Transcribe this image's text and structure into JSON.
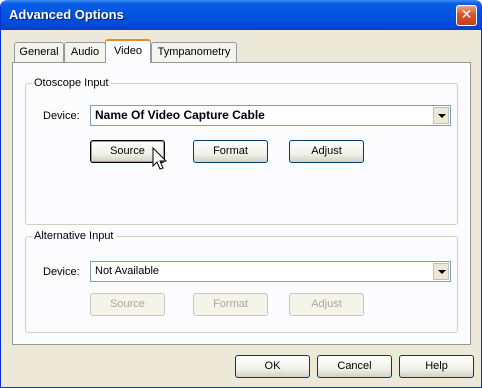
{
  "window": {
    "title": "Advanced Options",
    "close_icon": "close-icon"
  },
  "tabs": [
    {
      "label": "General",
      "active": false
    },
    {
      "label": "Audio",
      "active": false
    },
    {
      "label": "Video",
      "active": true
    },
    {
      "label": "Tympanometry",
      "active": false
    }
  ],
  "otoscope": {
    "legend": "Otoscope Input",
    "device_label": "Device:",
    "device_value": "Name Of Video Capture Cable",
    "buttons": {
      "source": "Source",
      "format": "Format",
      "adjust": "Adjust"
    }
  },
  "alternative": {
    "legend": "Alternative Input",
    "device_label": "Device:",
    "device_value": "Not Available",
    "buttons": {
      "source": "Source",
      "format": "Format",
      "adjust": "Adjust"
    }
  },
  "footer": {
    "ok": "OK",
    "cancel": "Cancel",
    "help": "Help"
  },
  "colors": {
    "titlebar": "#0053e1",
    "face": "#ece9d8",
    "close": "#d8552d",
    "active_tab_accent": "#e68b2c"
  }
}
